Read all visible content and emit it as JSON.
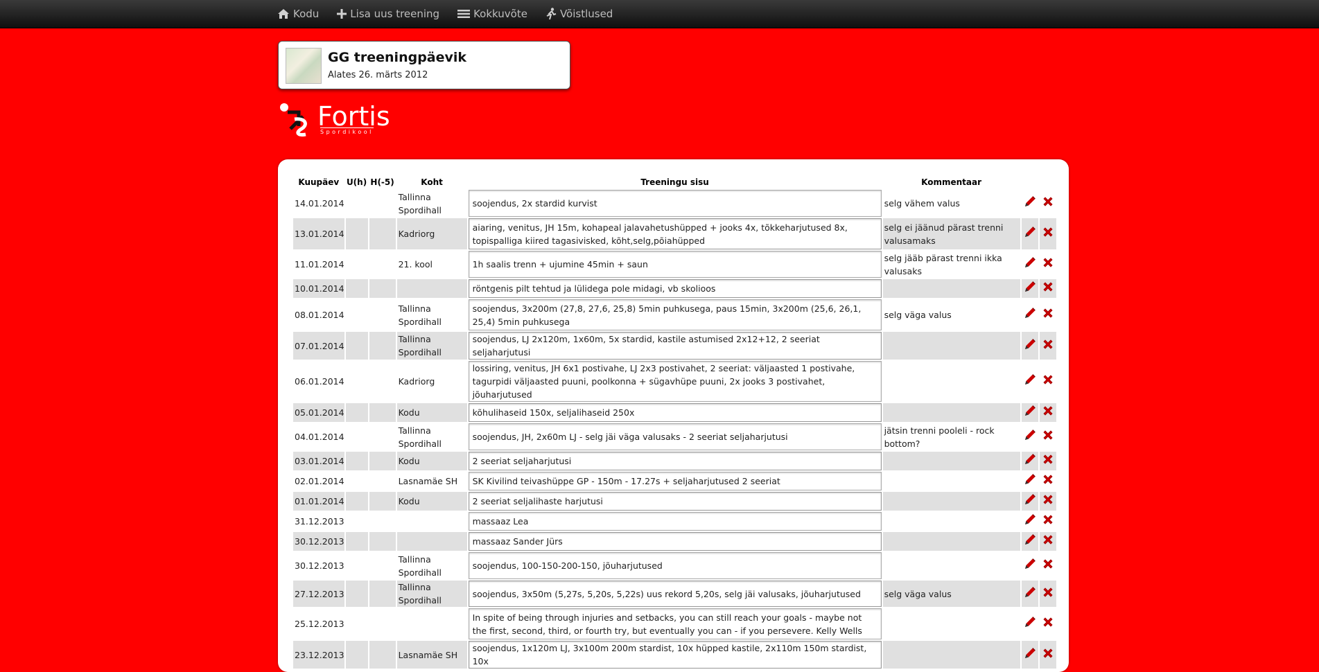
{
  "nav": [
    {
      "icon": "home-icon",
      "label": "Kodu"
    },
    {
      "icon": "plus-icon",
      "label": "Lisa uus treening"
    },
    {
      "icon": "list-icon",
      "label": "Kokkuvõte"
    },
    {
      "icon": "runner-icon",
      "label": "Võistlused"
    }
  ],
  "diary": {
    "title": "GG treeningpäevik",
    "subtitle": "Alates 26. märts 2012"
  },
  "logo": {
    "word": "Fortis",
    "tagline": "Spordikool"
  },
  "colors": {
    "background": "#ff0000",
    "edit_icon": "#cc0000",
    "delete_icon": "#cc0000"
  },
  "table": {
    "headers": {
      "date": "Kuupäev",
      "u": "U(h)",
      "h": "H(-5)",
      "place": "Koht",
      "content": "Treeningu sisu",
      "comment": "Kommentaar"
    },
    "rows": [
      {
        "date": "14.01.2014",
        "u": "",
        "h": "",
        "place": "Tallinna Spordihall",
        "content": "soojendus, 2x stardid kurvist",
        "comment": "selg vähem valus"
      },
      {
        "date": "13.01.2014",
        "u": "",
        "h": "",
        "place": "Kadriorg",
        "content": "aiaring, venitus, JH 15m, kohapeal jalavahetushüpped + jooks 4x, tõkkeharjutused 8x, topispalliga kiired tagasivisked, kõht,selg,põiahüpped",
        "comment": "selg ei jäänud pärast trenni valusamaks"
      },
      {
        "date": "11.01.2014",
        "u": "",
        "h": "",
        "place": "21. kool",
        "content": "1h saalis trenn + ujumine 45min + saun",
        "comment": "selg jääb pärast trenni ikka valusaks"
      },
      {
        "date": "10.01.2014",
        "u": "",
        "h": "",
        "place": "",
        "content": "röntgenis pilt tehtud ja lülidega pole midagi, vb skolioos",
        "comment": ""
      },
      {
        "date": "08.01.2014",
        "u": "",
        "h": "",
        "place": "Tallinna Spordihall",
        "content": "soojendus, 3x200m (27,8, 27,6, 25,8) 5min puhkusega, paus 15min, 3x200m (25,6, 26,1, 25,4) 5min puhkusega",
        "comment": "selg väga valus"
      },
      {
        "date": "07.01.2014",
        "u": "",
        "h": "",
        "place": "Tallinna Spordihall",
        "content": "soojendus, LJ 2x120m, 1x60m, 5x stardid, kastile astumised 2x12+12, 2 seeriat seljaharjutusi",
        "comment": ""
      },
      {
        "date": "06.01.2014",
        "u": "",
        "h": "",
        "place": "Kadriorg",
        "content": "lossiring, venitus, JH 6x1 postivahe, LJ 2x3 postivahet, 2 seeriat: väljaasted 1 postivahe, tagurpidi väljaasted puuni, poolkonna + sügavhüpe puuni, 2x jooks 3 postivahet, jõuharjutused",
        "comment": ""
      },
      {
        "date": "05.01.2014",
        "u": "",
        "h": "",
        "place": "Kodu",
        "content": "kõhulihaseid 150x, seljalihaseid 250x",
        "comment": ""
      },
      {
        "date": "04.01.2014",
        "u": "",
        "h": "",
        "place": "Tallinna Spordihall",
        "content": "soojendus, JH, 2x60m LJ - selg jäi väga valusaks - 2 seeriat seljaharjutusi",
        "comment": "jätsin trenni pooleli - rock bottom?"
      },
      {
        "date": "03.01.2014",
        "u": "",
        "h": "",
        "place": "Kodu",
        "content": "2 seeriat seljaharjutusi",
        "comment": ""
      },
      {
        "date": "02.01.2014",
        "u": "",
        "h": "",
        "place": "Lasnamäe SH",
        "content": "SK Kivilind teivashüppe GP - 150m - 17.27s + seljaharjutused 2 seeriat",
        "comment": ""
      },
      {
        "date": "01.01.2014",
        "u": "",
        "h": "",
        "place": "Kodu",
        "content": "2 seeriat seljalihaste harjutusi",
        "comment": ""
      },
      {
        "date": "31.12.2013",
        "u": "",
        "h": "",
        "place": "",
        "content": "massaaz Lea",
        "comment": ""
      },
      {
        "date": "30.12.2013",
        "u": "",
        "h": "",
        "place": "",
        "content": "massaaz Sander Jürs",
        "comment": ""
      },
      {
        "date": "30.12.2013",
        "u": "",
        "h": "",
        "place": "Tallinna Spordihall",
        "content": "soojendus, 100-150-200-150, jõuharjutused",
        "comment": ""
      },
      {
        "date": "27.12.2013",
        "u": "",
        "h": "",
        "place": "Tallinna Spordihall",
        "content": "soojendus, 3x50m (5,27s, 5,20s, 5,22s) uus rekord 5,20s, selg jäi valusaks, jõuharjutused",
        "comment": "selg väga valus"
      },
      {
        "date": "25.12.2013",
        "u": "",
        "h": "",
        "place": "",
        "content": "In spite of being through injuries and setbacks, you can still reach your goals - maybe not the first, second, third, or fourth try, but eventually you can - if you persevere. Kelly Wells",
        "comment": ""
      },
      {
        "date": "23.12.2013",
        "u": "",
        "h": "",
        "place": "Lasnamäe SH",
        "content": "soojendus, 1x120m LJ, 3x100m 200m stardist, 10x hüpped kastile, 2x110m 150m stardist, 10x",
        "comment": ""
      }
    ]
  }
}
